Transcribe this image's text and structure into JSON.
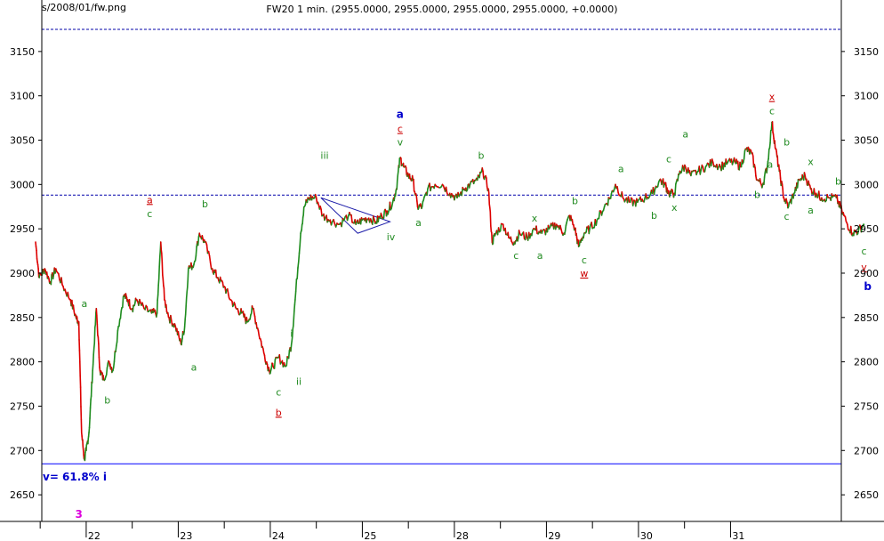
{
  "header": {
    "path": "s/2008/01/fw.png",
    "title": "FW20 1 min. (2955.0000, 2955.0000, 2955.0000, 2955.0000, +0.0000)"
  },
  "colors": {
    "up": "#1e8c1e",
    "down": "#dd0000",
    "grid_dashed": "#0000aa",
    "support_line": "#0000ff",
    "label_green": "#228b22",
    "label_red": "#cc0000",
    "label_blue": "#0000cc",
    "label_magenta": "#dd00dd"
  },
  "chart_data": {
    "type": "line",
    "xlabel": "",
    "ylabel": "",
    "x_ticks": [
      "22",
      "23",
      "24",
      "25",
      "28",
      "29",
      "30",
      "31"
    ],
    "y_ticks": [
      3150,
      3100,
      3050,
      3000,
      2950,
      2900,
      2850,
      2800,
      2750,
      2700,
      2650
    ],
    "ylim": [
      2620,
      3190
    ],
    "xlim": [
      0,
      8.4
    ],
    "grid": false,
    "legend": "none",
    "series": [
      {
        "values": [
          [
            0,
            2935
          ],
          [
            0.04,
            2895
          ],
          [
            0.1,
            2905
          ],
          [
            0.16,
            2890
          ],
          [
            0.22,
            2905
          ],
          [
            0.3,
            2885
          ],
          [
            0.38,
            2870
          ],
          [
            0.44,
            2850
          ],
          [
            0.47,
            2845
          ],
          [
            0.5,
            2720
          ],
          [
            0.53,
            2690
          ],
          [
            0.55,
            2700
          ],
          [
            0.58,
            2720
          ],
          [
            0.62,
            2790
          ],
          [
            0.66,
            2860
          ],
          [
            0.7,
            2790
          ],
          [
            0.74,
            2780
          ],
          [
            0.8,
            2800
          ],
          [
            0.84,
            2790
          ],
          [
            0.9,
            2840
          ],
          [
            0.96,
            2875
          ],
          [
            1.0,
            2870
          ],
          [
            1.05,
            2860
          ],
          [
            1.1,
            2870
          ],
          [
            1.18,
            2860
          ],
          [
            1.26,
            2855
          ],
          [
            1.32,
            2855
          ],
          [
            1.36,
            2935
          ],
          [
            1.4,
            2870
          ],
          [
            1.45,
            2850
          ],
          [
            1.52,
            2840
          ],
          [
            1.58,
            2820
          ],
          [
            1.62,
            2840
          ],
          [
            1.66,
            2905
          ],
          [
            1.72,
            2910
          ],
          [
            1.78,
            2945
          ],
          [
            1.84,
            2935
          ],
          [
            1.92,
            2905
          ],
          [
            1.98,
            2895
          ],
          [
            2.05,
            2885
          ],
          [
            2.12,
            2870
          ],
          [
            2.18,
            2860
          ],
          [
            2.24,
            2855
          ],
          [
            2.3,
            2845
          ],
          [
            2.36,
            2860
          ],
          [
            2.42,
            2835
          ],
          [
            2.48,
            2810
          ],
          [
            2.54,
            2790
          ],
          [
            2.58,
            2795
          ],
          [
            2.64,
            2805
          ],
          [
            2.72,
            2795
          ],
          [
            2.78,
            2820
          ],
          [
            2.82,
            2870
          ],
          [
            2.88,
            2945
          ],
          [
            2.92,
            2975
          ],
          [
            2.97,
            2985
          ],
          [
            3.05,
            2985
          ],
          [
            3.12,
            2965
          ],
          [
            3.2,
            2960
          ],
          [
            3.3,
            2955
          ],
          [
            3.4,
            2965
          ],
          [
            3.48,
            2955
          ],
          [
            3.55,
            2960
          ],
          [
            3.62,
            2962
          ],
          [
            3.7,
            2958
          ],
          [
            3.76,
            2965
          ],
          [
            3.82,
            2970
          ],
          [
            3.88,
            2980
          ],
          [
            3.92,
            2995
          ],
          [
            3.96,
            3030
          ],
          [
            4.0,
            3020
          ],
          [
            4.05,
            3010
          ],
          [
            4.1,
            3005
          ],
          [
            4.15,
            2975
          ],
          [
            4.2,
            2975
          ],
          [
            4.26,
            2995
          ],
          [
            4.34,
            3000
          ],
          [
            4.42,
            3000
          ],
          [
            4.5,
            2990
          ],
          [
            4.58,
            2985
          ],
          [
            4.66,
            2995
          ],
          [
            4.72,
            3000
          ],
          [
            4.8,
            3005
          ],
          [
            4.86,
            3015
          ],
          [
            4.92,
            2995
          ],
          [
            4.96,
            2935
          ],
          [
            5.0,
            2945
          ],
          [
            5.08,
            2955
          ],
          [
            5.14,
            2940
          ],
          [
            5.2,
            2935
          ],
          [
            5.26,
            2945
          ],
          [
            5.34,
            2940
          ],
          [
            5.42,
            2950
          ],
          [
            5.5,
            2945
          ],
          [
            5.58,
            2950
          ],
          [
            5.66,
            2955
          ],
          [
            5.74,
            2945
          ],
          [
            5.8,
            2965
          ],
          [
            5.86,
            2950
          ],
          [
            5.9,
            2930
          ],
          [
            5.96,
            2945
          ],
          [
            6.02,
            2950
          ],
          [
            6.1,
            2960
          ],
          [
            6.18,
            2975
          ],
          [
            6.24,
            2985
          ],
          [
            6.3,
            3000
          ],
          [
            6.38,
            2985
          ],
          [
            6.46,
            2980
          ],
          [
            6.54,
            2980
          ],
          [
            6.62,
            2985
          ],
          [
            6.7,
            2990
          ],
          [
            6.78,
            3005
          ],
          [
            6.84,
            3000
          ],
          [
            6.88,
            2990
          ],
          [
            6.94,
            2990
          ],
          [
            7.0,
            3015
          ],
          [
            7.06,
            3020
          ],
          [
            7.12,
            3010
          ],
          [
            7.2,
            3015
          ],
          [
            7.28,
            3020
          ],
          [
            7.36,
            3025
          ],
          [
            7.44,
            3020
          ],
          [
            7.52,
            3025
          ],
          [
            7.6,
            3025
          ],
          [
            7.66,
            3020
          ],
          [
            7.72,
            3040
          ],
          [
            7.78,
            3035
          ],
          [
            7.84,
            3005
          ],
          [
            7.9,
            3000
          ],
          [
            7.95,
            3020
          ],
          [
            8.0,
            3070
          ],
          [
            8.04,
            3040
          ],
          [
            8.08,
            3015
          ],
          [
            8.13,
            2985
          ],
          [
            8.18,
            2975
          ],
          [
            8.24,
            2990
          ],
          [
            8.3,
            3005
          ],
          [
            8.36,
            3010
          ],
          [
            8.42,
            2995
          ],
          [
            8.48,
            2990
          ],
          [
            8.54,
            2985
          ],
          [
            8.62,
            2985
          ],
          [
            8.7,
            2985
          ],
          [
            8.76,
            2970
          ],
          [
            8.82,
            2955
          ],
          [
            8.88,
            2945
          ],
          [
            8.94,
            2948
          ],
          [
            9.0,
            2955
          ]
        ]
      }
    ],
    "reference_lines": [
      {
        "y": 3175,
        "style": "dashed"
      },
      {
        "y": 2988,
        "style": "dashed"
      },
      {
        "y": 2685,
        "style": "solid"
      }
    ],
    "triangle": [
      [
        3.1,
        2985
      ],
      [
        3.5,
        2945
      ],
      [
        3.85,
        2958
      ]
    ],
    "annotations": [
      {
        "text": "a",
        "x": 0.53,
        "y": 2862,
        "color": "label_green"
      },
      {
        "text": "b",
        "x": 0.78,
        "y": 2753,
        "color": "label_green"
      },
      {
        "text": "3",
        "x": 0.47,
        "y": 2624,
        "color": "label_magenta",
        "bold": true
      },
      {
        "text": "a",
        "x": 1.72,
        "y": 2790,
        "color": "label_green"
      },
      {
        "text": "a",
        "x": 1.24,
        "y": 2979,
        "color": "label_red",
        "underline": true
      },
      {
        "text": "c",
        "x": 1.24,
        "y": 2963,
        "color": "label_green"
      },
      {
        "text": "b",
        "x": 1.84,
        "y": 2974,
        "color": "label_green"
      },
      {
        "text": "c",
        "x": 2.64,
        "y": 2762,
        "color": "label_green"
      },
      {
        "text": "b",
        "x": 2.64,
        "y": 2739,
        "color": "label_red",
        "underline": true
      },
      {
        "text": "i",
        "x": 2.78,
        "y": 2828,
        "color": "label_green"
      },
      {
        "text": "ii",
        "x": 2.86,
        "y": 2774,
        "color": "label_green"
      },
      {
        "text": "iii",
        "x": 3.14,
        "y": 3029,
        "color": "label_green"
      },
      {
        "text": "iv",
        "x": 3.86,
        "y": 2937,
        "color": "label_green"
      },
      {
        "text": "a",
        "x": 3.96,
        "y": 3075,
        "color": "label_blue",
        "bold": true
      },
      {
        "text": "c",
        "x": 3.96,
        "y": 3059,
        "color": "label_red",
        "underline": true
      },
      {
        "text": "v",
        "x": 3.96,
        "y": 3044,
        "color": "label_green"
      },
      {
        "text": "a",
        "x": 4.16,
        "y": 2953,
        "color": "label_green"
      },
      {
        "text": "b",
        "x": 4.84,
        "y": 3029,
        "color": "label_green"
      },
      {
        "text": "c",
        "x": 5.22,
        "y": 2916,
        "color": "label_green"
      },
      {
        "text": "x",
        "x": 5.42,
        "y": 2958,
        "color": "label_green"
      },
      {
        "text": "a",
        "x": 5.48,
        "y": 2916,
        "color": "label_green"
      },
      {
        "text": "b",
        "x": 5.86,
        "y": 2978,
        "color": "label_green"
      },
      {
        "text": "c",
        "x": 5.96,
        "y": 2911,
        "color": "label_green"
      },
      {
        "text": "w",
        "x": 5.96,
        "y": 2896,
        "color": "label_red",
        "underline": true
      },
      {
        "text": "a",
        "x": 6.36,
        "y": 3014,
        "color": "label_green"
      },
      {
        "text": "b",
        "x": 6.72,
        "y": 2961,
        "color": "label_green"
      },
      {
        "text": "c",
        "x": 6.88,
        "y": 3025,
        "color": "label_green"
      },
      {
        "text": "x",
        "x": 6.94,
        "y": 2970,
        "color": "label_green"
      },
      {
        "text": "a",
        "x": 7.06,
        "y": 3053,
        "color": "label_green"
      },
      {
        "text": "x",
        "x": 8.0,
        "y": 3095,
        "color": "label_red",
        "underline": true
      },
      {
        "text": "c",
        "x": 8.0,
        "y": 3079,
        "color": "label_green"
      },
      {
        "text": "b",
        "x": 8.16,
        "y": 3044,
        "color": "label_green"
      },
      {
        "text": "a",
        "x": 7.98,
        "y": 3019,
        "color": "label_green"
      },
      {
        "text": "b",
        "x": 7.84,
        "y": 2985,
        "color": "label_green"
      },
      {
        "text": "c",
        "x": 8.16,
        "y": 2960,
        "color": "label_green"
      },
      {
        "text": "x",
        "x": 8.42,
        "y": 3022,
        "color": "label_green"
      },
      {
        "text": "a",
        "x": 8.42,
        "y": 2967,
        "color": "label_green"
      },
      {
        "text": "b",
        "x": 8.72,
        "y": 3000,
        "color": "label_green"
      },
      {
        "text": "c",
        "x": 9.0,
        "y": 2921,
        "color": "label_green"
      },
      {
        "text": "y",
        "x": 9.0,
        "y": 2903,
        "color": "label_red",
        "underline": true
      },
      {
        "text": "b",
        "x": 9.04,
        "y": 2881,
        "color": "label_blue",
        "bold": true
      }
    ],
    "fib_label": "v= 61.8% i"
  }
}
